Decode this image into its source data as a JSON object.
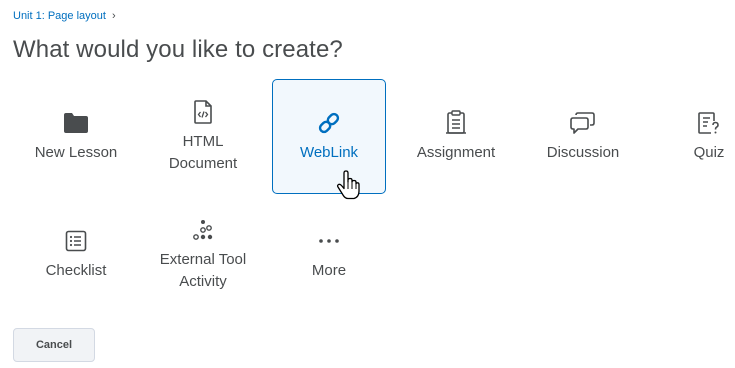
{
  "breadcrumb": {
    "link_label": "Unit 1: Page layout",
    "separator": "›"
  },
  "title": "What would you like to create?",
  "tiles": [
    {
      "label": "New Lesson",
      "icon": "folder-icon"
    },
    {
      "label": "HTML\nDocument",
      "icon": "html-file-icon"
    },
    {
      "label": "WebLink",
      "icon": "link-icon",
      "selected": true
    },
    {
      "label": "Assignment",
      "icon": "assignment-icon"
    },
    {
      "label": "Discussion",
      "icon": "discussion-icon"
    },
    {
      "label": "Quiz",
      "icon": "quiz-icon"
    },
    {
      "label": "Checklist",
      "icon": "checklist-icon"
    },
    {
      "label": "External Tool\nActivity",
      "icon": "external-tool-icon"
    },
    {
      "label": "More",
      "icon": "more-icon"
    }
  ],
  "footer": {
    "cancel_label": "Cancel"
  },
  "colors": {
    "accent": "#006fbf",
    "text": "#494c4e",
    "selected_bg": "#f2f8fd"
  }
}
